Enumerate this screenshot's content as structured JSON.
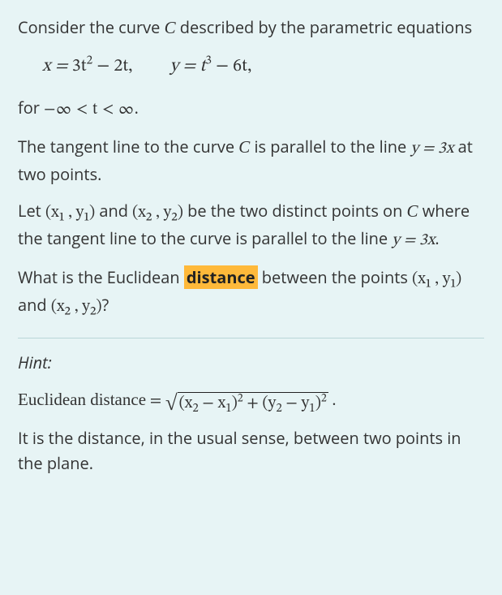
{
  "p1_a": "Consider the curve ",
  "p1_c": " described by the parametric equations",
  "eq_x_lhs": "x = ",
  "eq_x_rhs_a": "3t",
  "eq_x_rhs_b": " − 2t,",
  "eq_y_lhs": "y = ",
  "eq_y_rhs_a": "t",
  "eq_y_rhs_b": " − 6t,",
  "domain_a": "for ",
  "domain_b": "−∞ < t < ∞",
  "domain_c": ".",
  "p2_a": "The tangent line to the curve ",
  "p2_b": " is parallel to the line ",
  "line_eq": "y = 3x",
  "p2_c": " at two points.",
  "p3_a": "Let ",
  "pt1": "(x₁ , y₁)",
  "p3_b": "  and ",
  "pt2": "(x₂ , y₂)",
  "p3_c": " be the two distinct points on ",
  "p3_d": " where the tangent line to the curve is parallel to the line ",
  "p3_e": ".",
  "q_a": "What is the Euclidean ",
  "q_hl": "distance",
  "q_b": " between the points ",
  "q_c": " and ",
  "q_d": "?",
  "hint_label": "Hint:",
  "hint_name": "Euclidean distance",
  "hint_eq": " = ",
  "sqrt_a": "(x",
  "sqrt_b": " − x",
  "sqrt_c": ")",
  "sqrt_d": " + (y",
  "sqrt_e": " − y",
  "sqrt_f": ")",
  "hint_period": " .",
  "hint_txt": "It is the distance, in the usual sense, between two points in the plane.",
  "script_C": "C",
  "exp2": "2",
  "exp3": "3",
  "s1": "1",
  "s2": "2",
  "sqrt_sym": "√"
}
